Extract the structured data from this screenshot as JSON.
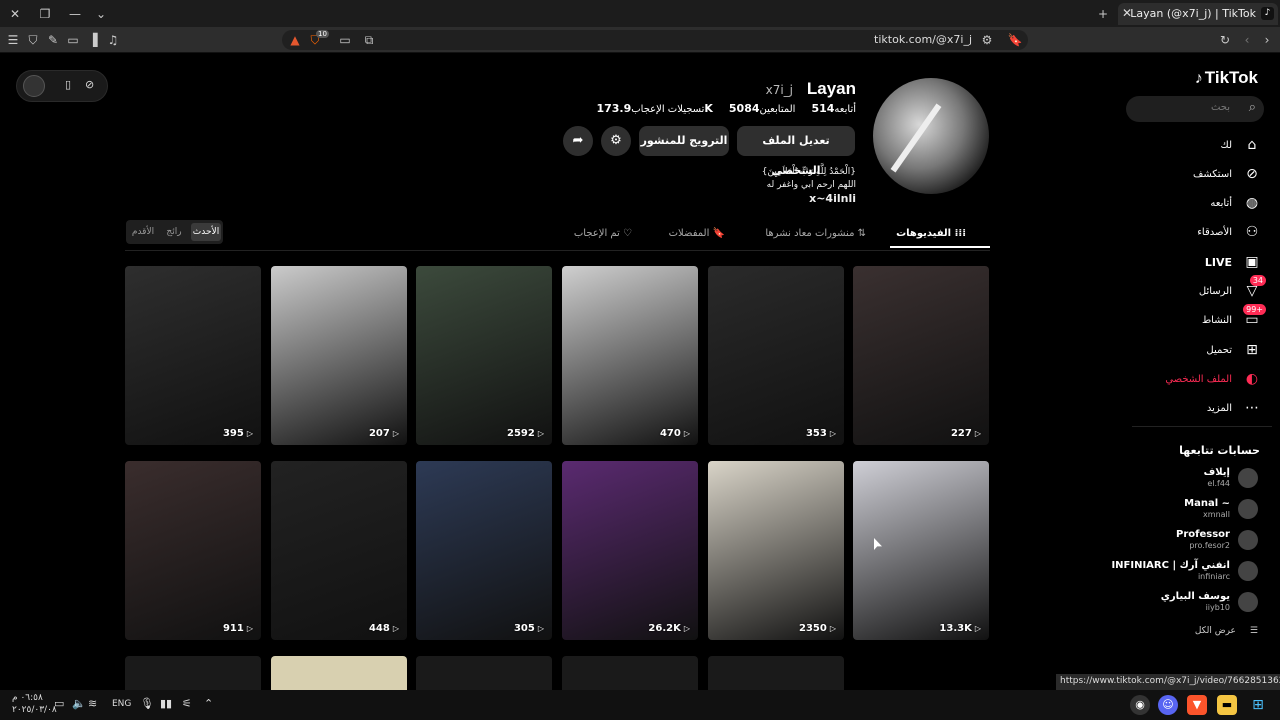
{
  "browser": {
    "tab_title": "Layan (@x7i_j) | TikTok",
    "tab_favicon": "tiktok-icon",
    "address": "tiktok.com/@x7i_j",
    "shield_count": "10"
  },
  "page_corner": {
    "icons": [
      "avatar",
      "phone-icon",
      "compass-icon"
    ]
  },
  "sidebar": {
    "logo": "TikTok",
    "search_placeholder": "بحث",
    "nav": [
      {
        "label": "لك",
        "icon": "home-icon"
      },
      {
        "label": "استكشف",
        "icon": "compass-icon"
      },
      {
        "label": "أتابعه",
        "icon": "following-icon"
      },
      {
        "label": "الأصدقاء",
        "icon": "friends-icon"
      },
      {
        "label": "LIVE",
        "icon": "live-icon"
      },
      {
        "label": "الرسائل",
        "icon": "messages-icon",
        "badge": "34"
      },
      {
        "label": "النشاط",
        "icon": "activity-icon",
        "badge": "99+"
      },
      {
        "label": "تحميل",
        "icon": "upload-icon"
      },
      {
        "label": "الملف الشخصي",
        "icon": "profile-icon"
      },
      {
        "label": "المزيد",
        "icon": "more-icon"
      }
    ],
    "following_header": "حسابات تتابعها",
    "following": [
      {
        "name": "إيلاف",
        "handle": "el.f44"
      },
      {
        "name": "Manal ~",
        "handle": "xmnall"
      },
      {
        "name": "Professor",
        "handle": "pro.fesor2"
      },
      {
        "name": "INFINIARC | انفني آرك",
        "handle": "infiniarc"
      },
      {
        "name": "يوسف البياري",
        "handle": "iiyb10"
      }
    ],
    "see_all": "عرض الكل"
  },
  "profile": {
    "name": "Layan",
    "handle": "x7i_j",
    "following_count": "514",
    "following_label": "أتابعه",
    "followers_count": "5084",
    "followers_label": "المتابعين",
    "likes_count": "173.9K",
    "likes_label": "تسجيلات الإعجاب",
    "edit_button": "تعديل الملف الشخصي",
    "promote_button": "الترويج للمنشور",
    "bio_line1": "{الْحَمْدُ لِلَّهِ رَبِّ الْعَالَمِينَ}",
    "bio_line2": "اللهم ارحم ابي واغفر له",
    "bio_link": "x~4ilnli"
  },
  "tabs": [
    {
      "label": "الفيديوهات",
      "icon": "grid-icon",
      "active": true
    },
    {
      "label": "منشورات معاد نشرها",
      "icon": "repost-icon"
    },
    {
      "label": "المفضلات",
      "icon": "bookmark-icon"
    },
    {
      "label": "تم الإعجاب",
      "icon": "heart-icon"
    }
  ],
  "sort": [
    "الأحدث",
    "رائج",
    "الأقدم"
  ],
  "videos": [
    {
      "views": "227",
      "color": "#3a3030"
    },
    {
      "views": "353",
      "color": "#2a2a2a"
    },
    {
      "views": "470",
      "color": "#cfcfcf"
    },
    {
      "views": "2592",
      "color": "#3c4a3c"
    },
    {
      "views": "207",
      "color": "#cbcbcb"
    },
    {
      "views": "395",
      "color": "#2e2e2e"
    },
    {
      "views": "13.3K",
      "color": "#cfcfd6"
    },
    {
      "views": "2350",
      "color": "#d9d4c8"
    },
    {
      "views": "26.2K",
      "color": "#5a2a70"
    },
    {
      "views": "305",
      "color": "#2d3a55"
    },
    {
      "views": "448",
      "color": "#222222"
    },
    {
      "views": "911",
      "color": "#3a2d2d"
    }
  ],
  "status_url": "https://www.tiktok.com/@x7i_j/video/7662851362207616264",
  "taskbar": {
    "time": "٠٦:٥٨ م",
    "date": "٢٠٢٥/٠٣/٠٨",
    "lang": "ENG"
  }
}
